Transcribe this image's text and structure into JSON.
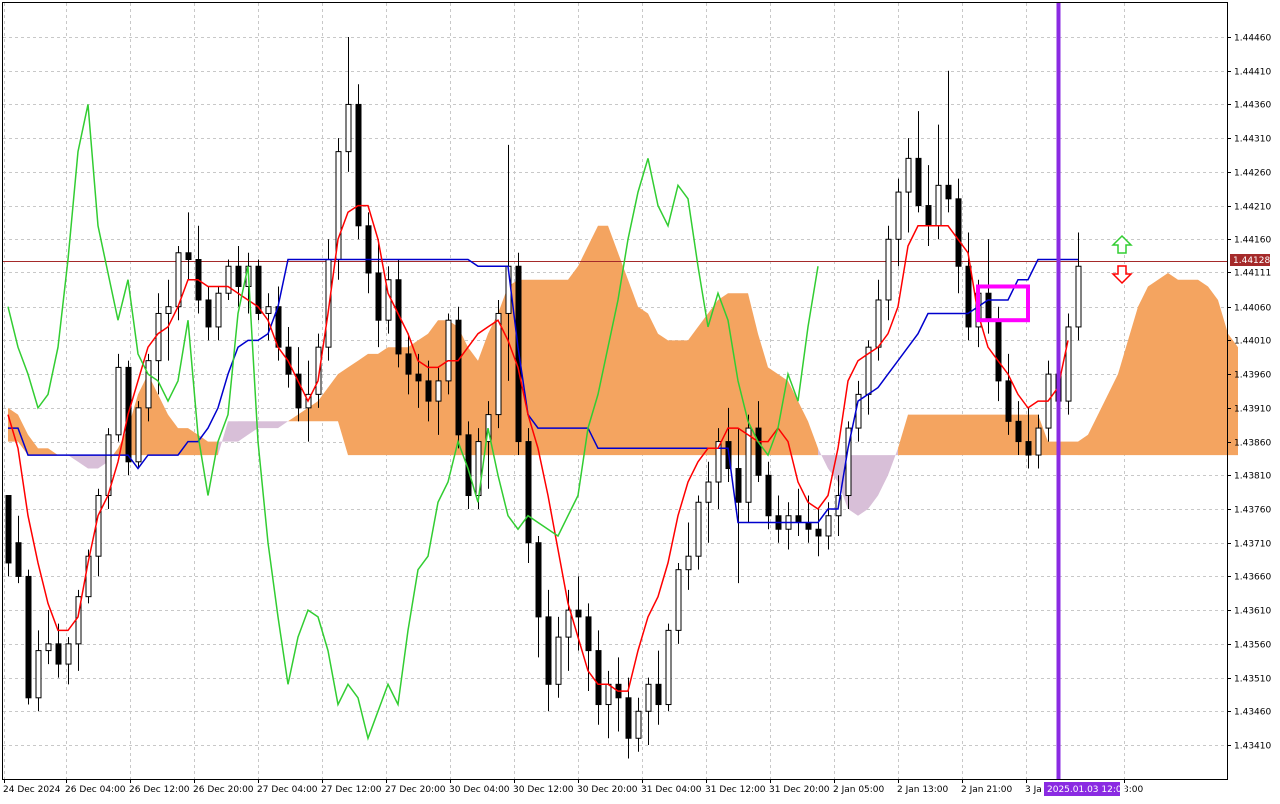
{
  "chart_data": {
    "type": "candlestick",
    "y_ticks": [
      "1.44460",
      "1.44410",
      "1.44360",
      "1.44310",
      "1.44260",
      "1.44210",
      "1.44160",
      "1.44111",
      "1.44060",
      "1.44010",
      "1.43960",
      "1.43910",
      "1.43860",
      "1.43810",
      "1.43760",
      "1.43710",
      "1.43660",
      "1.43610",
      "1.43560",
      "1.43510",
      "1.43460",
      "1.43410"
    ],
    "ylim": [
      1.4338,
      1.4451
    ],
    "x_ticks": [
      "24 Dec 2024",
      "26 Dec 04:00",
      "26 Dec 12:00",
      "26 Dec 20:00",
      "27 Dec 04:00",
      "27 Dec 12:00",
      "27 Dec 20:00",
      "30 Dec 04:00",
      "30 Dec 12:00",
      "30 Dec 20:00",
      "31 Dec 04:00",
      "31 Dec 12:00",
      "31 Dec 20:00",
      "2 Jan 05:00",
      "2 Jan 13:00",
      "2 Jan 21:00",
      "3 Ja",
      "3:00"
    ],
    "current_price": "1.44128",
    "current_price_value": 1.44128,
    "cursor_time_label": "2025.01.03 12:00",
    "colors": {
      "bull_candle": "#ffffff",
      "bear_candle": "#000000",
      "tenkan": "#ff0000",
      "kijun": "#0000cd",
      "chikou": "#32cd32",
      "kumo_bull": "#f4a460",
      "kumo_bear": "#d8bfd8",
      "price_line": "#a52a2a",
      "cursor_line": "#8a2be2",
      "highlight_box": "#ff00ff",
      "arrow_up": "#32cd32",
      "arrow_down": "#ff0000"
    },
    "candles": [
      [
        1.4378,
        1.4378,
        1.4366,
        1.4368
      ],
      [
        1.4371,
        1.4375,
        1.4365,
        1.4366
      ],
      [
        1.4366,
        1.4367,
        1.4347,
        1.4348
      ],
      [
        1.4348,
        1.4358,
        1.4346,
        1.4355
      ],
      [
        1.4355,
        1.4361,
        1.4353,
        1.4356
      ],
      [
        1.4356,
        1.4359,
        1.4351,
        1.4353
      ],
      [
        1.4353,
        1.4357,
        1.435,
        1.4356
      ],
      [
        1.4356,
        1.4364,
        1.4352,
        1.4363
      ],
      [
        1.4363,
        1.437,
        1.4362,
        1.4369
      ],
      [
        1.4369,
        1.4379,
        1.4366,
        1.4378
      ],
      [
        1.4378,
        1.4388,
        1.4376,
        1.4387
      ],
      [
        1.4387,
        1.4399,
        1.4386,
        1.4397
      ],
      [
        1.4397,
        1.4398,
        1.4381,
        1.4383
      ],
      [
        1.4383,
        1.4392,
        1.4382,
        1.4391
      ],
      [
        1.4391,
        1.4399,
        1.4389,
        1.4398
      ],
      [
        1.4398,
        1.4408,
        1.4393,
        1.4405
      ],
      [
        1.4405,
        1.441,
        1.4398,
        1.4406
      ],
      [
        1.4406,
        1.4415,
        1.4404,
        1.4414
      ],
      [
        1.4414,
        1.442,
        1.441,
        1.4413
      ],
      [
        1.4413,
        1.4418,
        1.4405,
        1.4407
      ],
      [
        1.4407,
        1.4409,
        1.4401,
        1.4403
      ],
      [
        1.4403,
        1.4409,
        1.4401,
        1.4408
      ],
      [
        1.4408,
        1.4413,
        1.4407,
        1.4412
      ],
      [
        1.4412,
        1.4415,
        1.4406,
        1.4409
      ],
      [
        1.4409,
        1.4414,
        1.4405,
        1.4412
      ],
      [
        1.4412,
        1.4413,
        1.4404,
        1.4405
      ],
      [
        1.4405,
        1.4408,
        1.4401,
        1.4406
      ],
      [
        1.4406,
        1.4409,
        1.4398,
        1.44
      ],
      [
        1.44,
        1.4403,
        1.4394,
        1.4396
      ],
      [
        1.4396,
        1.44,
        1.4389,
        1.4391
      ],
      [
        1.4391,
        1.4398,
        1.4386,
        1.4393
      ],
      [
        1.4393,
        1.4402,
        1.4391,
        1.44
      ],
      [
        1.44,
        1.4416,
        1.4398,
        1.4413
      ],
      [
        1.4413,
        1.4431,
        1.441,
        1.4429
      ],
      [
        1.4429,
        1.4446,
        1.4426,
        1.4436
      ],
      [
        1.4436,
        1.4439,
        1.4416,
        1.4418
      ],
      [
        1.4418,
        1.442,
        1.4408,
        1.4411
      ],
      [
        1.4411,
        1.4416,
        1.44,
        1.4404
      ],
      [
        1.4404,
        1.4412,
        1.4402,
        1.441
      ],
      [
        1.441,
        1.4413,
        1.4397,
        1.4399
      ],
      [
        1.4399,
        1.4402,
        1.4393,
        1.4396
      ],
      [
        1.4396,
        1.4399,
        1.4391,
        1.4395
      ],
      [
        1.4395,
        1.4398,
        1.4389,
        1.4392
      ],
      [
        1.4392,
        1.4397,
        1.4387,
        1.4395
      ],
      [
        1.4395,
        1.4405,
        1.4393,
        1.4404
      ],
      [
        1.4404,
        1.4406,
        1.4385,
        1.4387
      ],
      [
        1.4387,
        1.4389,
        1.4376,
        1.4378
      ],
      [
        1.4378,
        1.4388,
        1.4376,
        1.4386
      ],
      [
        1.4386,
        1.4392,
        1.4379,
        1.439
      ],
      [
        1.439,
        1.4407,
        1.4388,
        1.4405
      ],
      [
        1.4405,
        1.443,
        1.4395,
        1.4412
      ],
      [
        1.4412,
        1.4414,
        1.4384,
        1.4386
      ],
      [
        1.4386,
        1.4388,
        1.4368,
        1.4371
      ],
      [
        1.4371,
        1.4372,
        1.4354,
        1.436
      ],
      [
        1.436,
        1.4364,
        1.4346,
        1.435
      ],
      [
        1.435,
        1.436,
        1.4348,
        1.4357
      ],
      [
        1.4357,
        1.4364,
        1.4352,
        1.4361
      ],
      [
        1.4361,
        1.4366,
        1.4355,
        1.436
      ],
      [
        1.436,
        1.4362,
        1.4349,
        1.4355
      ],
      [
        1.4355,
        1.4358,
        1.4344,
        1.4347
      ],
      [
        1.4347,
        1.4352,
        1.4342,
        1.435
      ],
      [
        1.435,
        1.4354,
        1.4343,
        1.4348
      ],
      [
        1.4348,
        1.4351,
        1.4339,
        1.4342
      ],
      [
        1.4342,
        1.4348,
        1.434,
        1.4346
      ],
      [
        1.4346,
        1.4351,
        1.4341,
        1.435
      ],
      [
        1.435,
        1.4355,
        1.4344,
        1.4347
      ],
      [
        1.4347,
        1.4359,
        1.4346,
        1.4358
      ],
      [
        1.4358,
        1.4368,
        1.4356,
        1.4367
      ],
      [
        1.4367,
        1.4374,
        1.4364,
        1.4369
      ],
      [
        1.4369,
        1.4378,
        1.4367,
        1.4377
      ],
      [
        1.4377,
        1.4383,
        1.4371,
        1.438
      ],
      [
        1.438,
        1.4388,
        1.4376,
        1.4386
      ],
      [
        1.4386,
        1.4391,
        1.438,
        1.4382
      ],
      [
        1.4382,
        1.4388,
        1.4365,
        1.4377
      ],
      [
        1.4377,
        1.439,
        1.4374,
        1.4388
      ],
      [
        1.4388,
        1.4392,
        1.438,
        1.4381
      ],
      [
        1.4381,
        1.4383,
        1.4373,
        1.4375
      ],
      [
        1.4375,
        1.4378,
        1.4371,
        1.4373
      ],
      [
        1.4373,
        1.4377,
        1.437,
        1.4375
      ],
      [
        1.4375,
        1.4379,
        1.4372,
        1.4374
      ],
      [
        1.4374,
        1.4378,
        1.4371,
        1.4373
      ],
      [
        1.4373,
        1.4376,
        1.4369,
        1.4372
      ],
      [
        1.4372,
        1.4377,
        1.437,
        1.4375
      ],
      [
        1.4375,
        1.4381,
        1.4372,
        1.4378
      ],
      [
        1.4378,
        1.4389,
        1.4376,
        1.4388
      ],
      [
        1.4388,
        1.4395,
        1.4386,
        1.4393
      ],
      [
        1.4393,
        1.4401,
        1.439,
        1.44
      ],
      [
        1.44,
        1.441,
        1.4398,
        1.4407
      ],
      [
        1.4407,
        1.4418,
        1.4404,
        1.4416
      ],
      [
        1.4416,
        1.4425,
        1.4412,
        1.4423
      ],
      [
        1.4423,
        1.4431,
        1.4417,
        1.4428
      ],
      [
        1.4428,
        1.4435,
        1.442,
        1.4421
      ],
      [
        1.4421,
        1.4427,
        1.4415,
        1.4418
      ],
      [
        1.4418,
        1.4433,
        1.4416,
        1.4424
      ],
      [
        1.4424,
        1.4441,
        1.442,
        1.4422
      ],
      [
        1.4422,
        1.4425,
        1.4408,
        1.4412
      ],
      [
        1.4412,
        1.4417,
        1.4401,
        1.4403
      ],
      [
        1.4403,
        1.441,
        1.44,
        1.4408
      ],
      [
        1.4408,
        1.4416,
        1.4402,
        1.4404
      ],
      [
        1.4404,
        1.4406,
        1.4392,
        1.4395
      ],
      [
        1.4395,
        1.4399,
        1.4387,
        1.4389
      ],
      [
        1.4389,
        1.4392,
        1.4384,
        1.4386
      ],
      [
        1.4386,
        1.4391,
        1.4382,
        1.4384
      ],
      [
        1.4384,
        1.439,
        1.4382,
        1.4388
      ],
      [
        1.4388,
        1.4398,
        1.4386,
        1.4396
      ],
      [
        1.4396,
        1.4399,
        1.439,
        1.4392
      ],
      [
        1.4392,
        1.4405,
        1.439,
        1.4403
      ],
      [
        1.4403,
        1.4417,
        1.4401,
        1.4412
      ]
    ],
    "tenkan": [
      1.439,
      1.4385,
      1.4375,
      1.4368,
      1.4362,
      1.4358,
      1.4358,
      1.436,
      1.4368,
      1.4375,
      1.4378,
      1.4383,
      1.439,
      1.4395,
      1.44,
      1.4402,
      1.4403,
      1.4406,
      1.441,
      1.441,
      1.4409,
      1.4409,
      1.4409,
      1.4408,
      1.4407,
      1.4406,
      1.4404,
      1.44,
      1.4398,
      1.4395,
      1.4392,
      1.4395,
      1.4405,
      1.4416,
      1.442,
      1.4421,
      1.4421,
      1.4416,
      1.4408,
      1.4405,
      1.4402,
      1.4398,
      1.4397,
      1.4397,
      1.4398,
      1.4398,
      1.44,
      1.4402,
      1.4403,
      1.4404,
      1.4401,
      1.4397,
      1.439,
      1.4385,
      1.4378,
      1.437,
      1.4362,
      1.4357,
      1.4352,
      1.435,
      1.435,
      1.4349,
      1.4349,
      1.4355,
      1.436,
      1.4363,
      1.4368,
      1.4375,
      1.438,
      1.4383,
      1.4385,
      1.4385,
      1.4388,
      1.4388,
      1.4387,
      1.4386,
      1.4386,
      1.4388,
      1.4386,
      1.438,
      1.4377,
      1.4376,
      1.4378,
      1.4385,
      1.4395,
      1.4398,
      1.4399,
      1.44,
      1.4402,
      1.4406,
      1.4415,
      1.4418,
      1.4418,
      1.4418,
      1.4418,
      1.4416,
      1.4414,
      1.4405,
      1.44,
      1.4398,
      1.4396,
      1.4393,
      1.4391,
      1.4392,
      1.4392,
      1.4394,
      1.4401
    ],
    "kijun": [
      1.4388,
      1.4388,
      1.4384,
      1.4384,
      1.4384,
      1.4384,
      1.4384,
      1.4384,
      1.4384,
      1.4384,
      1.4384,
      1.4384,
      1.4384,
      1.4382,
      1.4384,
      1.4384,
      1.4384,
      1.4384,
      1.4386,
      1.4386,
      1.4388,
      1.4391,
      1.4396,
      1.44,
      1.4401,
      1.4401,
      1.4402,
      1.4406,
      1.4413,
      1.4413,
      1.4413,
      1.4413,
      1.4413,
      1.4413,
      1.4413,
      1.4413,
      1.4413,
      1.4413,
      1.4413,
      1.4413,
      1.4413,
      1.4413,
      1.4413,
      1.4413,
      1.4413,
      1.4413,
      1.4413,
      1.4412,
      1.4412,
      1.4412,
      1.4412,
      1.44,
      1.439,
      1.4388,
      1.4388,
      1.4388,
      1.4388,
      1.4388,
      1.4388,
      1.4385,
      1.4385,
      1.4385,
      1.4385,
      1.4385,
      1.4385,
      1.4385,
      1.4385,
      1.4385,
      1.4385,
      1.4385,
      1.4385,
      1.4385,
      1.4385,
      1.4374,
      1.4374,
      1.4374,
      1.4374,
      1.4374,
      1.4374,
      1.4374,
      1.4374,
      1.4374,
      1.4376,
      1.4376,
      1.4385,
      1.4392,
      1.4393,
      1.4394,
      1.4396,
      1.4398,
      1.44,
      1.4402,
      1.4405,
      1.4405,
      1.4405,
      1.4405,
      1.4405,
      1.4406,
      1.4407,
      1.4407,
      1.4407,
      1.441,
      1.441,
      1.4413,
      1.4413,
      1.4413,
      1.4413,
      1.4413
    ],
    "chikou_offset": 26,
    "kumo": {
      "senkou_a": [
        1.4391,
        1.439,
        1.4387,
        1.4385,
        1.4385,
        1.4384,
        1.4384,
        1.4383,
        1.4382,
        1.4382,
        1.4383,
        1.4385,
        1.4388,
        1.4393,
        1.4396,
        1.4393,
        1.439,
        1.4388,
        1.4388,
        1.4387,
        1.4386,
        1.4386,
        1.4386,
        1.4386,
        1.4387,
        1.4388,
        1.4388,
        1.4388,
        1.4389,
        1.439,
        1.4391,
        1.4392,
        1.4394,
        1.4396,
        1.4397,
        1.4398,
        1.4399,
        1.4399,
        1.44,
        1.44,
        1.44,
        1.4401,
        1.4402,
        1.4404,
        1.4404,
        1.4403,
        1.44,
        1.4398,
        1.4402,
        1.4405,
        1.4409,
        1.441,
        1.441,
        1.441,
        1.441,
        1.441,
        1.441,
        1.4412,
        1.4415,
        1.4418,
        1.4418,
        1.4414,
        1.441,
        1.4406,
        1.4405,
        1.4402,
        1.4401,
        1.4401,
        1.4401,
        1.4403,
        1.4405,
        1.4407,
        1.4408,
        1.4408,
        1.4408,
        1.4402,
        1.4397,
        1.4396,
        1.4395,
        1.4392,
        1.4389,
        1.4385,
        1.4382,
        1.438,
        1.4376,
        1.4375,
        1.4376,
        1.4378,
        1.4381,
        1.4385,
        1.439,
        1.439,
        1.439,
        1.439,
        1.439,
        1.439,
        1.439,
        1.439,
        1.439,
        1.439,
        1.439,
        1.439,
        1.439,
        1.439,
        1.4386,
        1.4386,
        1.4386,
        1.4386,
        1.4387,
        1.439,
        1.4393,
        1.4396,
        1.4401,
        1.4406,
        1.4409,
        1.441,
        1.4411,
        1.441,
        1.441,
        1.441,
        1.4409,
        1.4407,
        1.4402,
        1.44
      ],
      "senkou_b": [
        1.4386,
        1.4386,
        1.4384,
        1.4384,
        1.4384,
        1.4384,
        1.4384,
        1.4384,
        1.4384,
        1.4384,
        1.4384,
        1.4384,
        1.4384,
        1.4384,
        1.4384,
        1.4384,
        1.4384,
        1.4384,
        1.4384,
        1.4384,
        1.4384,
        1.4384,
        1.4389,
        1.4389,
        1.4389,
        1.4389,
        1.4389,
        1.4389,
        1.4389,
        1.4389,
        1.4389,
        1.4389,
        1.4389,
        1.4389,
        1.4384,
        1.4384,
        1.4384,
        1.4384,
        1.4384,
        1.4384,
        1.4384,
        1.4384,
        1.4384,
        1.4384,
        1.4384,
        1.4384,
        1.4384,
        1.4384,
        1.4384,
        1.4384,
        1.4384,
        1.4384,
        1.4384,
        1.4384,
        1.4384,
        1.4384,
        1.4384,
        1.4384,
        1.4384,
        1.4384,
        1.4384,
        1.4384,
        1.4384,
        1.4384,
        1.4384,
        1.4384,
        1.4384,
        1.4384,
        1.4384,
        1.4384,
        1.4384,
        1.4384,
        1.4384,
        1.4384,
        1.4384,
        1.4384,
        1.4384,
        1.4384,
        1.4384,
        1.4384,
        1.4384,
        1.4384,
        1.4384,
        1.4384,
        1.4384,
        1.4384,
        1.4384,
        1.4384,
        1.4384,
        1.4384,
        1.4384,
        1.4384,
        1.4384,
        1.4384,
        1.4384,
        1.4384,
        1.4384,
        1.4384,
        1.4384,
        1.4384,
        1.4384,
        1.4384,
        1.4384,
        1.4384,
        1.4384,
        1.4384,
        1.4384,
        1.4384,
        1.4384,
        1.4384,
        1.4384,
        1.4384,
        1.4384,
        1.4384,
        1.4384,
        1.4384,
        1.4384,
        1.4384,
        1.4384,
        1.4384,
        1.4384,
        1.4384,
        1.4384,
        1.4384
      ]
    },
    "highlight_box_price_range": [
      1.4404,
      1.4409
    ],
    "highlight_box_bar_range": [
      97,
      102
    ],
    "cursor_bar": 105
  }
}
